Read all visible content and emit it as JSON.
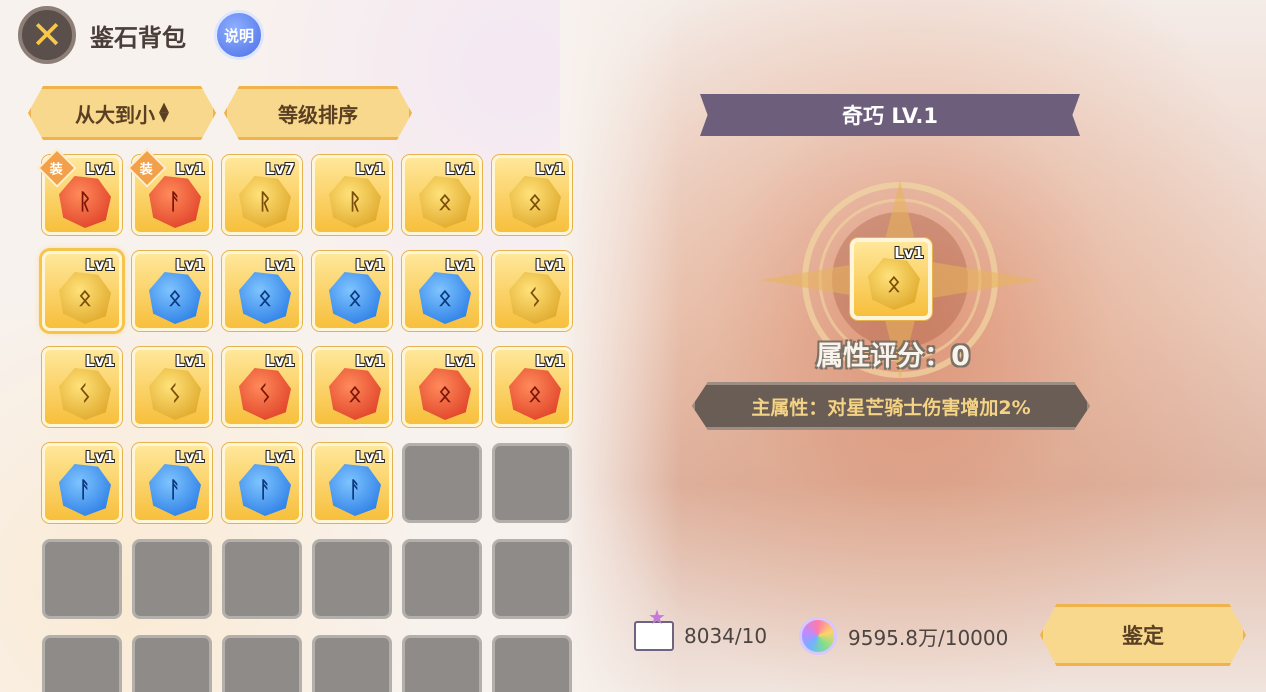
{
  "header": {
    "title": "鉴石背包",
    "help_label": "说明",
    "close_icon": "close-icon"
  },
  "sort": {
    "size_label": "从大到小",
    "size_arrows": "▲▼",
    "level_label": "等级排序"
  },
  "inventory": {
    "slots": [
      {
        "color": "red",
        "level": "Lv1",
        "equipped": true,
        "glyph": "ᚱ"
      },
      {
        "color": "red",
        "level": "Lv1",
        "equipped": true,
        "glyph": "ᚨ"
      },
      {
        "color": "gold",
        "level": "Lv7",
        "equipped": false,
        "glyph": "ᚱ"
      },
      {
        "color": "gold",
        "level": "Lv1",
        "equipped": false,
        "glyph": "ᚱ"
      },
      {
        "color": "gold",
        "level": "Lv1",
        "equipped": false,
        "glyph": "ᛟ"
      },
      {
        "color": "gold",
        "level": "Lv1",
        "equipped": false,
        "glyph": "ᛟ"
      },
      {
        "color": "gold",
        "level": "Lv1",
        "equipped": false,
        "glyph": "ᛟ",
        "selected": true
      },
      {
        "color": "blue",
        "level": "Lv1",
        "equipped": false,
        "glyph": "ᛟ"
      },
      {
        "color": "blue",
        "level": "Lv1",
        "equipped": false,
        "glyph": "ᛟ"
      },
      {
        "color": "blue",
        "level": "Lv1",
        "equipped": false,
        "glyph": "ᛟ"
      },
      {
        "color": "blue",
        "level": "Lv1",
        "equipped": false,
        "glyph": "ᛟ"
      },
      {
        "color": "gold",
        "level": "Lv1",
        "equipped": false,
        "glyph": "ᛊ"
      },
      {
        "color": "gold",
        "level": "Lv1",
        "equipped": false,
        "glyph": "ᛊ"
      },
      {
        "color": "gold",
        "level": "Lv1",
        "equipped": false,
        "glyph": "ᛊ"
      },
      {
        "color": "red",
        "level": "Lv1",
        "equipped": false,
        "glyph": "ᛊ"
      },
      {
        "color": "red",
        "level": "Lv1",
        "equipped": false,
        "glyph": "ᛟ"
      },
      {
        "color": "red",
        "level": "Lv1",
        "equipped": false,
        "glyph": "ᛟ"
      },
      {
        "color": "red",
        "level": "Lv1",
        "equipped": false,
        "glyph": "ᛟ"
      },
      {
        "color": "blue",
        "level": "Lv1",
        "equipped": false,
        "glyph": "ᚨ"
      },
      {
        "color": "blue",
        "level": "Lv1",
        "equipped": false,
        "glyph": "ᚨ"
      },
      {
        "color": "blue",
        "level": "Lv1",
        "equipped": false,
        "glyph": "ᚨ"
      },
      {
        "color": "blue",
        "level": "Lv1",
        "equipped": false,
        "glyph": "ᚨ"
      },
      {
        "empty": true
      },
      {
        "empty": true
      },
      {
        "empty": true
      },
      {
        "empty": true
      },
      {
        "empty": true
      },
      {
        "empty": true
      },
      {
        "empty": true
      },
      {
        "empty": true
      },
      {
        "empty": true
      },
      {
        "empty": true
      },
      {
        "empty": true
      },
      {
        "empty": true
      },
      {
        "empty": true
      },
      {
        "empty": true
      }
    ],
    "equip_mark": "装"
  },
  "detail": {
    "name": "奇巧 LV.1",
    "gem_level": "Lv1",
    "gem_glyph": "ᛟ",
    "score": "属性评分：0",
    "main_attr": "主属性：对星芒骑士伤害增加2%"
  },
  "resources": {
    "books": "8034/10",
    "coins": "9595.8万/10000"
  },
  "identify_label": "鉴定",
  "colors": {
    "accent": "#f7d88d",
    "banner": "#6d5e7c"
  }
}
